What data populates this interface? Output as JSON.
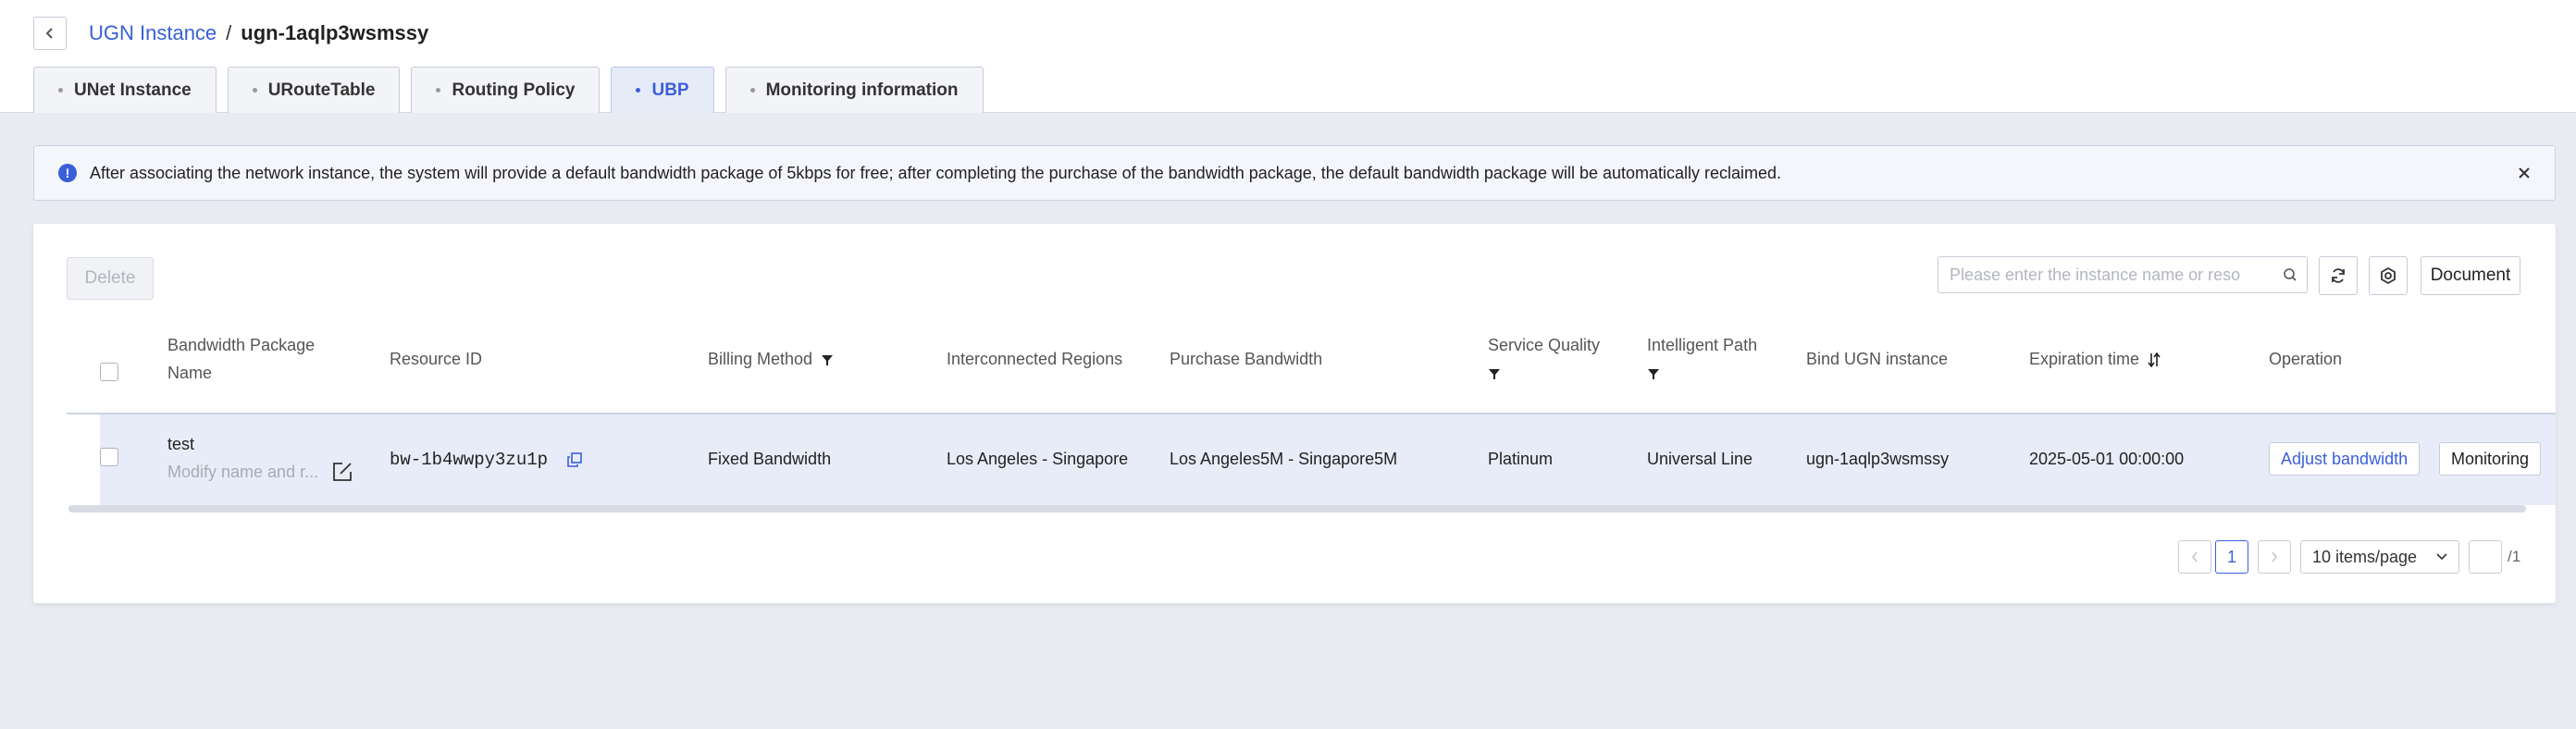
{
  "breadcrumb": {
    "parent": "UGN Instance",
    "separator": "/",
    "current": "ugn-1aqlp3wsmssy"
  },
  "tabs": [
    {
      "label": "UNet Instance",
      "active": false
    },
    {
      "label": "URouteTable",
      "active": false
    },
    {
      "label": "Routing Policy",
      "active": false
    },
    {
      "label": "UBP",
      "active": true
    },
    {
      "label": "Monitoring information",
      "active": false
    }
  ],
  "notice": {
    "text": "After associating the network instance, the system will provide a default bandwidth package of 5kbps for free; after completing the purchase of the bandwidth package, the default bandwidth package will be automatically reclaimed."
  },
  "toolbar": {
    "delete_label": "Delete",
    "search_placeholder": "Please enter the instance name or reso",
    "document_label": "Document"
  },
  "table": {
    "headers": {
      "name_line1": "Bandwidth Package",
      "name_line2": "Name",
      "resource_id": "Resource ID",
      "billing": "Billing Method",
      "regions": "Interconnected Regions",
      "purchase_bw": "Purchase Bandwidth",
      "quality": "Service Quality",
      "path": "Intelligent Path",
      "bind": "Bind UGN instance",
      "expiration": "Expiration time",
      "operation": "Operation"
    },
    "rows": [
      {
        "name": "test",
        "remark_placeholder": "Modify name and r...",
        "resource_id": "bw-1b4wwpy3zu1p",
        "billing": "Fixed Bandwidth",
        "regions": "Los Angeles - Singapore",
        "purchase_bw": "Los Angeles5M - Singapore5M",
        "quality": "Platinum",
        "path": "Universal Line",
        "bind": "ugn-1aqlp3wsmssy",
        "expiration": "2025-05-01 00:00:00",
        "op_adjust": "Adjust bandwidth",
        "op_monitor": "Monitoring"
      }
    ]
  },
  "pagination": {
    "current_page": "1",
    "page_size": "10 items/page",
    "total": "/1"
  },
  "colors": {
    "accent": "#3b5fd9",
    "background": "#e9ebf2",
    "row_highlight": "#e8ecf8"
  },
  "icons": [
    "back-icon",
    "info-icon",
    "close-icon",
    "search-icon",
    "refresh-icon",
    "settings-icon",
    "filter-icon",
    "sort-icon",
    "copy-icon",
    "edit-icon",
    "chevron-down-icon"
  ]
}
